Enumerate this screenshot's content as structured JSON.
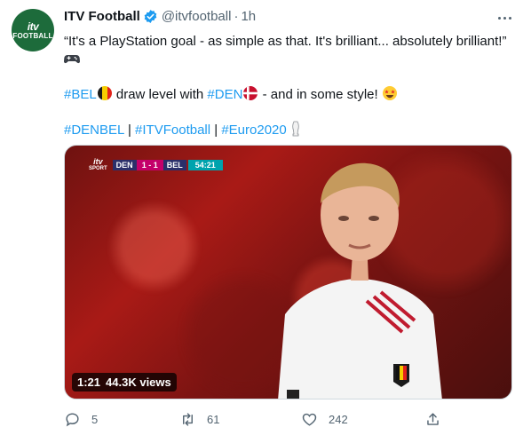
{
  "account": {
    "avatar_line1": "itv",
    "avatar_line2": "FOOTBALL",
    "name": "ITV Football",
    "handle": "@itvfootball",
    "separator": "·",
    "time": "1h"
  },
  "tweet": {
    "line1": "“It's a PlayStation goal - as simple as that. It's brilliant... absolutely brilliant!”",
    "line2_tag1": "#BEL",
    "line2_text1": " draw level with ",
    "line2_tag2": "#DEN",
    "line2_text2": " - and in some style! ",
    "line3_tag1": "#DENBEL",
    "line3_sep1": " | ",
    "line3_tag2": "#ITVFootball",
    "line3_sep2": " | ",
    "line3_tag3": "#Euro2020"
  },
  "video": {
    "logo_top": "itv",
    "logo_bottom": "SPORT",
    "team_home": "DEN",
    "score": "1 - 1",
    "team_away": "BEL",
    "clock": "54:21",
    "duration": "1:21",
    "views": "44.3K views"
  },
  "actions": {
    "replies": "5",
    "retweets": "61",
    "likes": "242"
  },
  "colors": {
    "accent": "#1d9bf0",
    "muted": "#536471",
    "avatar_bg": "#1d6b3b"
  }
}
